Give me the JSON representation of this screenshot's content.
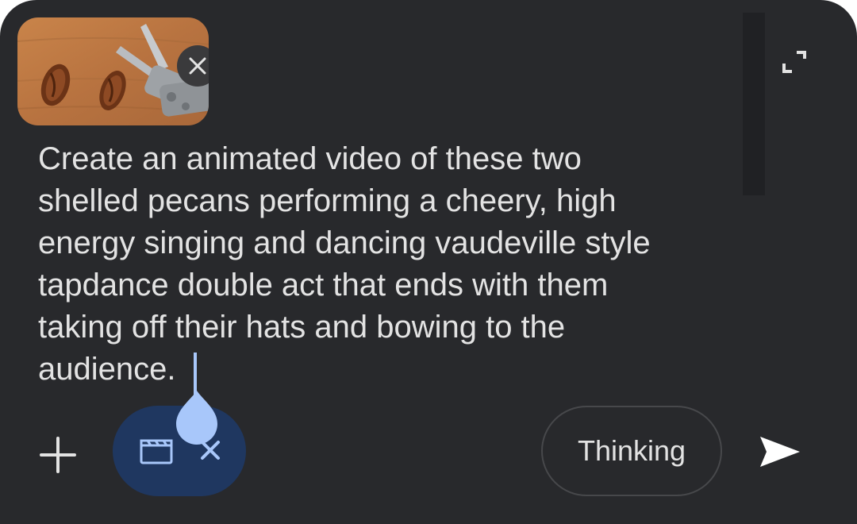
{
  "attachment": {
    "image_description_icon": "pecans-and-pliers-photo",
    "remove_icon": "close-icon"
  },
  "prompt": {
    "text": "Create an animated video of these two\nshelled pecans performing a cheery, high\nenergy singing and dancing vaudeville style\ntapdance double act that ends with them\ntaking off their hats and bowing to the\naudience."
  },
  "toolbar": {
    "add_icon": "plus-icon",
    "video_chip_icon": "video-icon",
    "video_chip_close_icon": "close-icon",
    "mode_label": "Thinking",
    "send_icon": "send-icon",
    "expand_icon": "expand-icon"
  },
  "colors": {
    "background": "#28292c",
    "text": "#e3e3e3",
    "chip_background": "#1f3760",
    "accent": "#a8c7fa"
  }
}
